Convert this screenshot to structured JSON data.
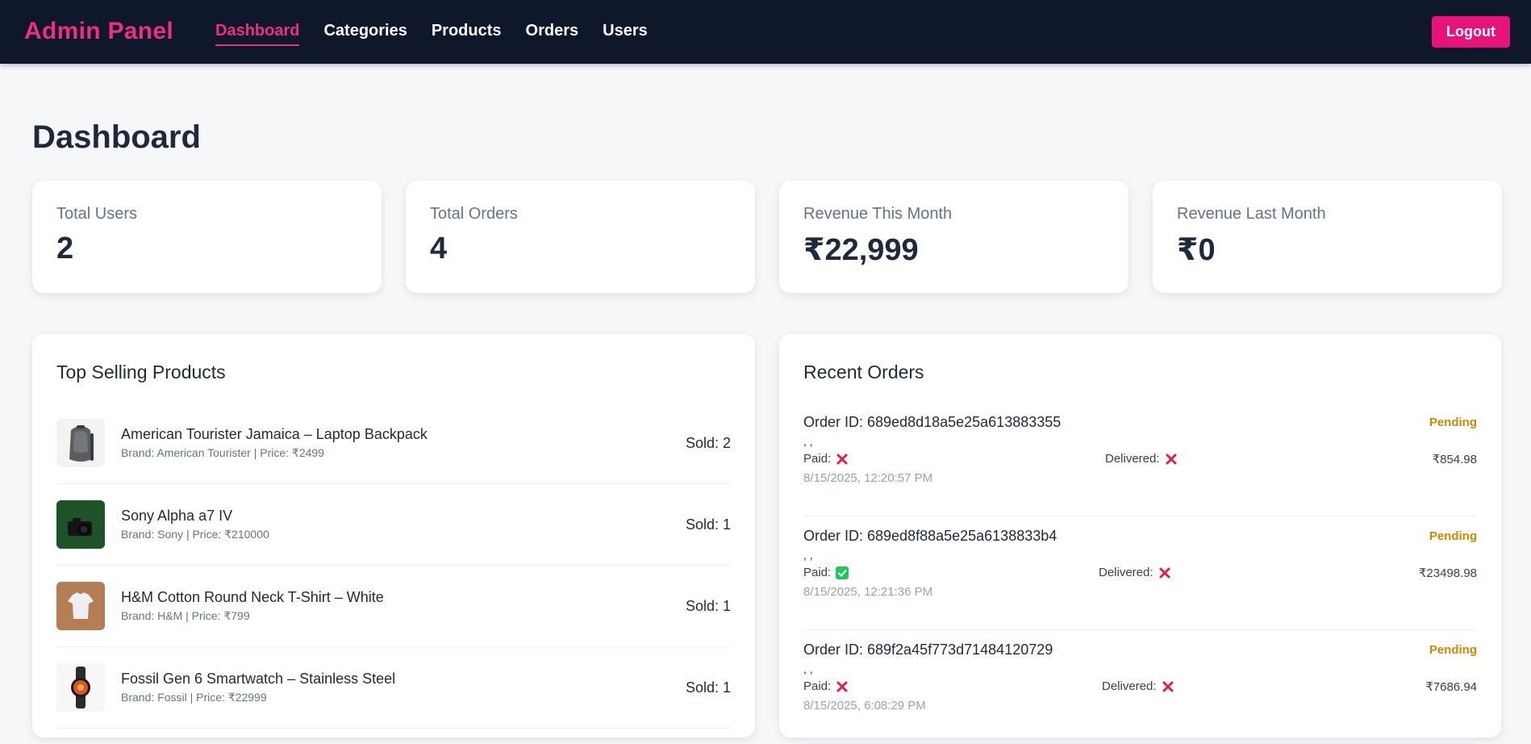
{
  "nav": {
    "brand": "Admin Panel",
    "links": [
      "Dashboard",
      "Categories",
      "Products",
      "Orders",
      "Users"
    ],
    "active": "Dashboard",
    "logout_label": "Logout",
    "brand_color": "#ec2f82",
    "background": "#0f172a"
  },
  "page": {
    "title": "Dashboard"
  },
  "stats": [
    {
      "label": "Total Users",
      "value": "2"
    },
    {
      "label": "Total Orders",
      "value": "4"
    },
    {
      "label": "Revenue This Month",
      "value": "₹22,999"
    },
    {
      "label": "Revenue Last Month",
      "value": "₹0"
    }
  ],
  "top_products": {
    "title": "Top Selling Products",
    "items": [
      {
        "name": "American Tourister Jamaica – Laptop Backpack",
        "meta": "Brand: American Tourister | Price: ₹2499",
        "sold": "Sold: 2",
        "icon": "backpack-thumbnail"
      },
      {
        "name": "Sony Alpha a7 IV",
        "meta": "Brand: Sony | Price: ₹210000",
        "sold": "Sold: 1",
        "icon": "camera-thumbnail"
      },
      {
        "name": "H&M Cotton Round Neck T-Shirt – White",
        "meta": "Brand: H&M | Price: ₹799",
        "sold": "Sold: 1",
        "icon": "tshirt-thumbnail"
      },
      {
        "name": "Fossil Gen 6 Smartwatch – Stainless Steel",
        "meta": "Brand: Fossil | Price: ₹22999",
        "sold": "Sold: 1",
        "icon": "smartwatch-thumbnail"
      }
    ]
  },
  "recent_orders": {
    "title": "Recent Orders",
    "items": [
      {
        "id": "Order ID: 689ed8d18a5e25a613883355",
        "status": "Pending",
        "commas": ", ,",
        "paid_label": "Paid:",
        "paid": false,
        "delivered_label": "Delivered:",
        "delivered": false,
        "total": "₹854.98",
        "date": "8/15/2025, 12:20:57 PM"
      },
      {
        "id": "Order ID: 689ed8f88a5e25a6138833b4",
        "status": "Pending",
        "commas": ", ,",
        "paid_label": "Paid:",
        "paid": true,
        "delivered_label": "Delivered:",
        "delivered": false,
        "total": "₹23498.98",
        "date": "8/15/2025, 12:21:36 PM"
      },
      {
        "id": "Order ID: 689f2a45f773d71484120729",
        "status": "Pending",
        "commas": ", ,",
        "paid_label": "Paid:",
        "paid": false,
        "delivered_label": "Delivered:",
        "delivered": false,
        "total": "₹7686.94",
        "date": "8/15/2025, 6:08:29 PM"
      }
    ]
  }
}
